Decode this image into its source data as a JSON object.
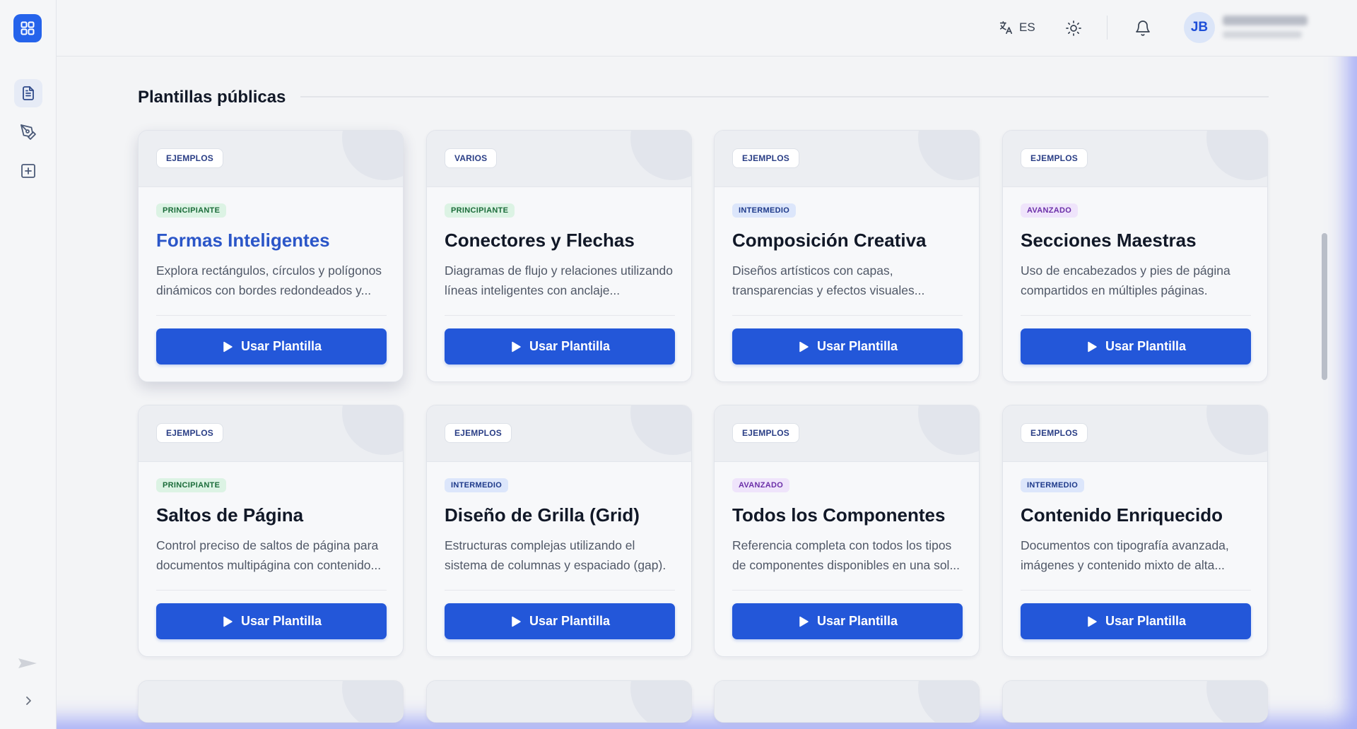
{
  "header": {
    "language": "ES",
    "user_initials": "JB"
  },
  "section": {
    "title": "Plantillas públicas"
  },
  "cards": [
    {
      "category": "EJEMPLOS",
      "level": "PRINCIPIANTE",
      "title": "Formas Inteligentes",
      "desc1": "Explora rectángulos, círculos y polígonos",
      "desc2": "dinámicos con bordes redondeados y...",
      "button": "Usar Plantilla"
    },
    {
      "category": "VARIOS",
      "level": "PRINCIPIANTE",
      "title": "Conectores y Flechas",
      "desc1": "Diagramas de flujo y relaciones utilizando",
      "desc2": "líneas inteligentes con anclaje...",
      "button": "Usar Plantilla"
    },
    {
      "category": "EJEMPLOS",
      "level": "INTERMEDIO",
      "title": "Composición Creativa",
      "desc1": "Diseños artísticos con capas,",
      "desc2": "transparencias y efectos visuales...",
      "button": "Usar Plantilla"
    },
    {
      "category": "EJEMPLOS",
      "level": "AVANZADO",
      "title": "Secciones Maestras",
      "desc1": "Uso de encabezados y pies de página",
      "desc2": "compartidos en múltiples páginas.",
      "button": "Usar Plantilla"
    },
    {
      "category": "EJEMPLOS",
      "level": "PRINCIPIANTE",
      "title": "Saltos de Página",
      "desc1": "Control preciso de saltos de página para",
      "desc2": "documentos multipágina con contenido...",
      "button": "Usar Plantilla"
    },
    {
      "category": "EJEMPLOS",
      "level": "INTERMEDIO",
      "title": "Diseño de Grilla (Grid)",
      "desc1": "Estructuras complejas utilizando el",
      "desc2": "sistema de columnas y espaciado (gap).",
      "button": "Usar Plantilla"
    },
    {
      "category": "EJEMPLOS",
      "level": "AVANZADO",
      "title": "Todos los Componentes",
      "desc1": "Referencia completa con todos los tipos",
      "desc2": "de componentes disponibles en una sol...",
      "button": "Usar Plantilla"
    },
    {
      "category": "EJEMPLOS",
      "level": "INTERMEDIO",
      "title": "Contenido Enriquecido",
      "desc1": "Documentos con tipografía avanzada,",
      "desc2": "imágenes y contenido mixto de alta...",
      "button": "Usar Plantilla"
    }
  ],
  "colors": {
    "accent": "#2357d9",
    "level_principiante": "#1b6c3a",
    "level_intermedio": "#1e3a8a",
    "level_avanzado": "#6b2fa8"
  },
  "icons": {
    "logo": "grid-icon",
    "sidebar": [
      "document-icon",
      "pen-tool-icon",
      "plus-square-icon"
    ],
    "header": [
      "translate-icon",
      "sun-icon",
      "bell-icon",
      "chevron-down-icon"
    ]
  }
}
